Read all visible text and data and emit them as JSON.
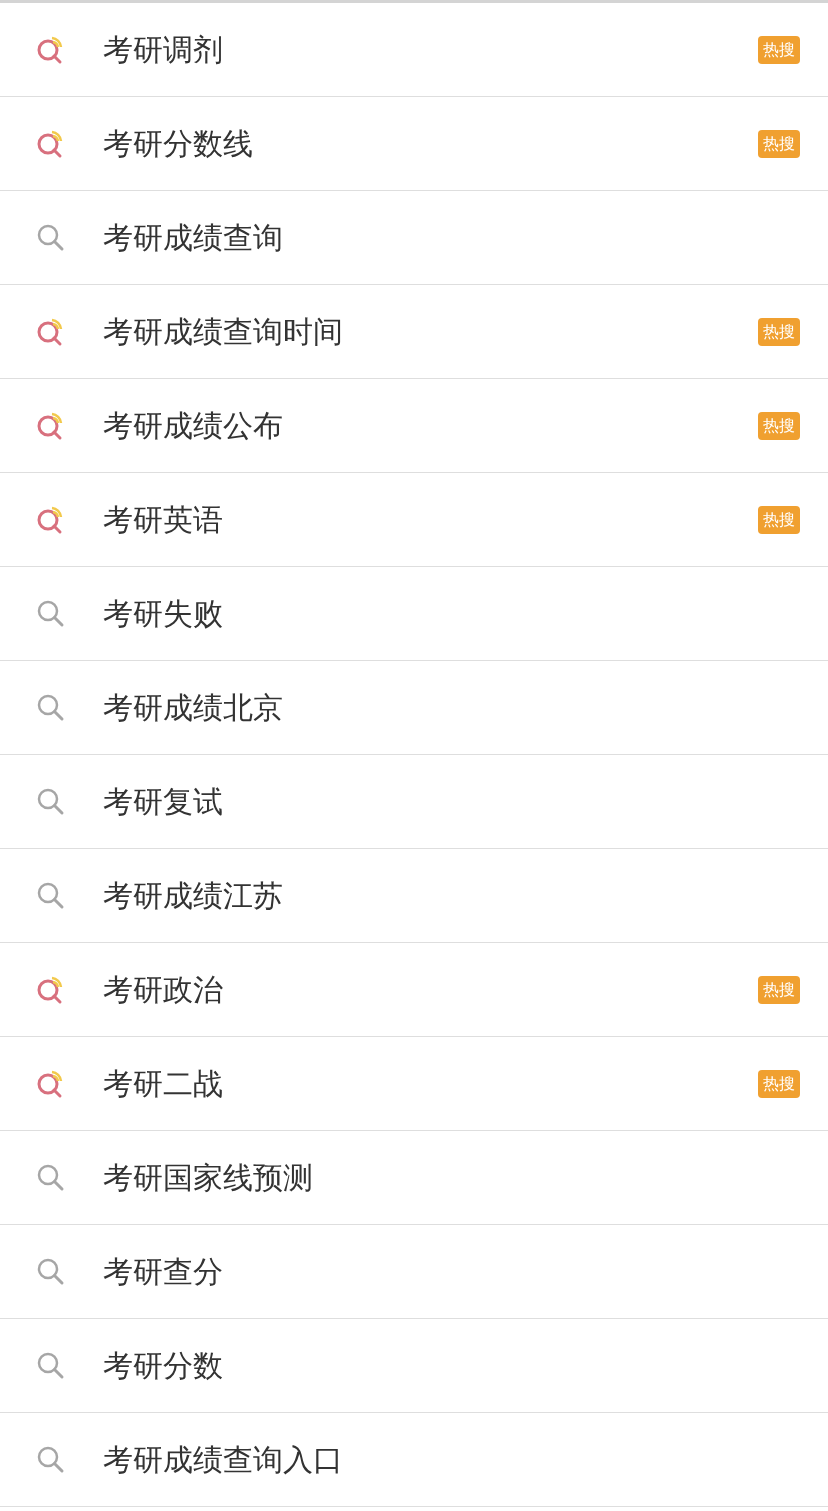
{
  "suggestions": [
    {
      "text": "考研调剂",
      "hot": true,
      "badge": "热搜"
    },
    {
      "text": "考研分数线",
      "hot": true,
      "badge": "热搜"
    },
    {
      "text": "考研成绩查询",
      "hot": false
    },
    {
      "text": "考研成绩查询时间",
      "hot": true,
      "badge": "热搜"
    },
    {
      "text": "考研成绩公布",
      "hot": true,
      "badge": "热搜"
    },
    {
      "text": "考研英语",
      "hot": true,
      "badge": "热搜"
    },
    {
      "text": "考研失败",
      "hot": false
    },
    {
      "text": "考研成绩北京",
      "hot": false
    },
    {
      "text": "考研复试",
      "hot": false
    },
    {
      "text": "考研成绩江苏",
      "hot": false
    },
    {
      "text": "考研政治",
      "hot": true,
      "badge": "热搜"
    },
    {
      "text": "考研二战",
      "hot": true,
      "badge": "热搜"
    },
    {
      "text": "考研国家线预测",
      "hot": false
    },
    {
      "text": "考研查分",
      "hot": false
    },
    {
      "text": "考研分数",
      "hot": false
    },
    {
      "text": "考研成绩查询入口",
      "hot": false
    }
  ]
}
